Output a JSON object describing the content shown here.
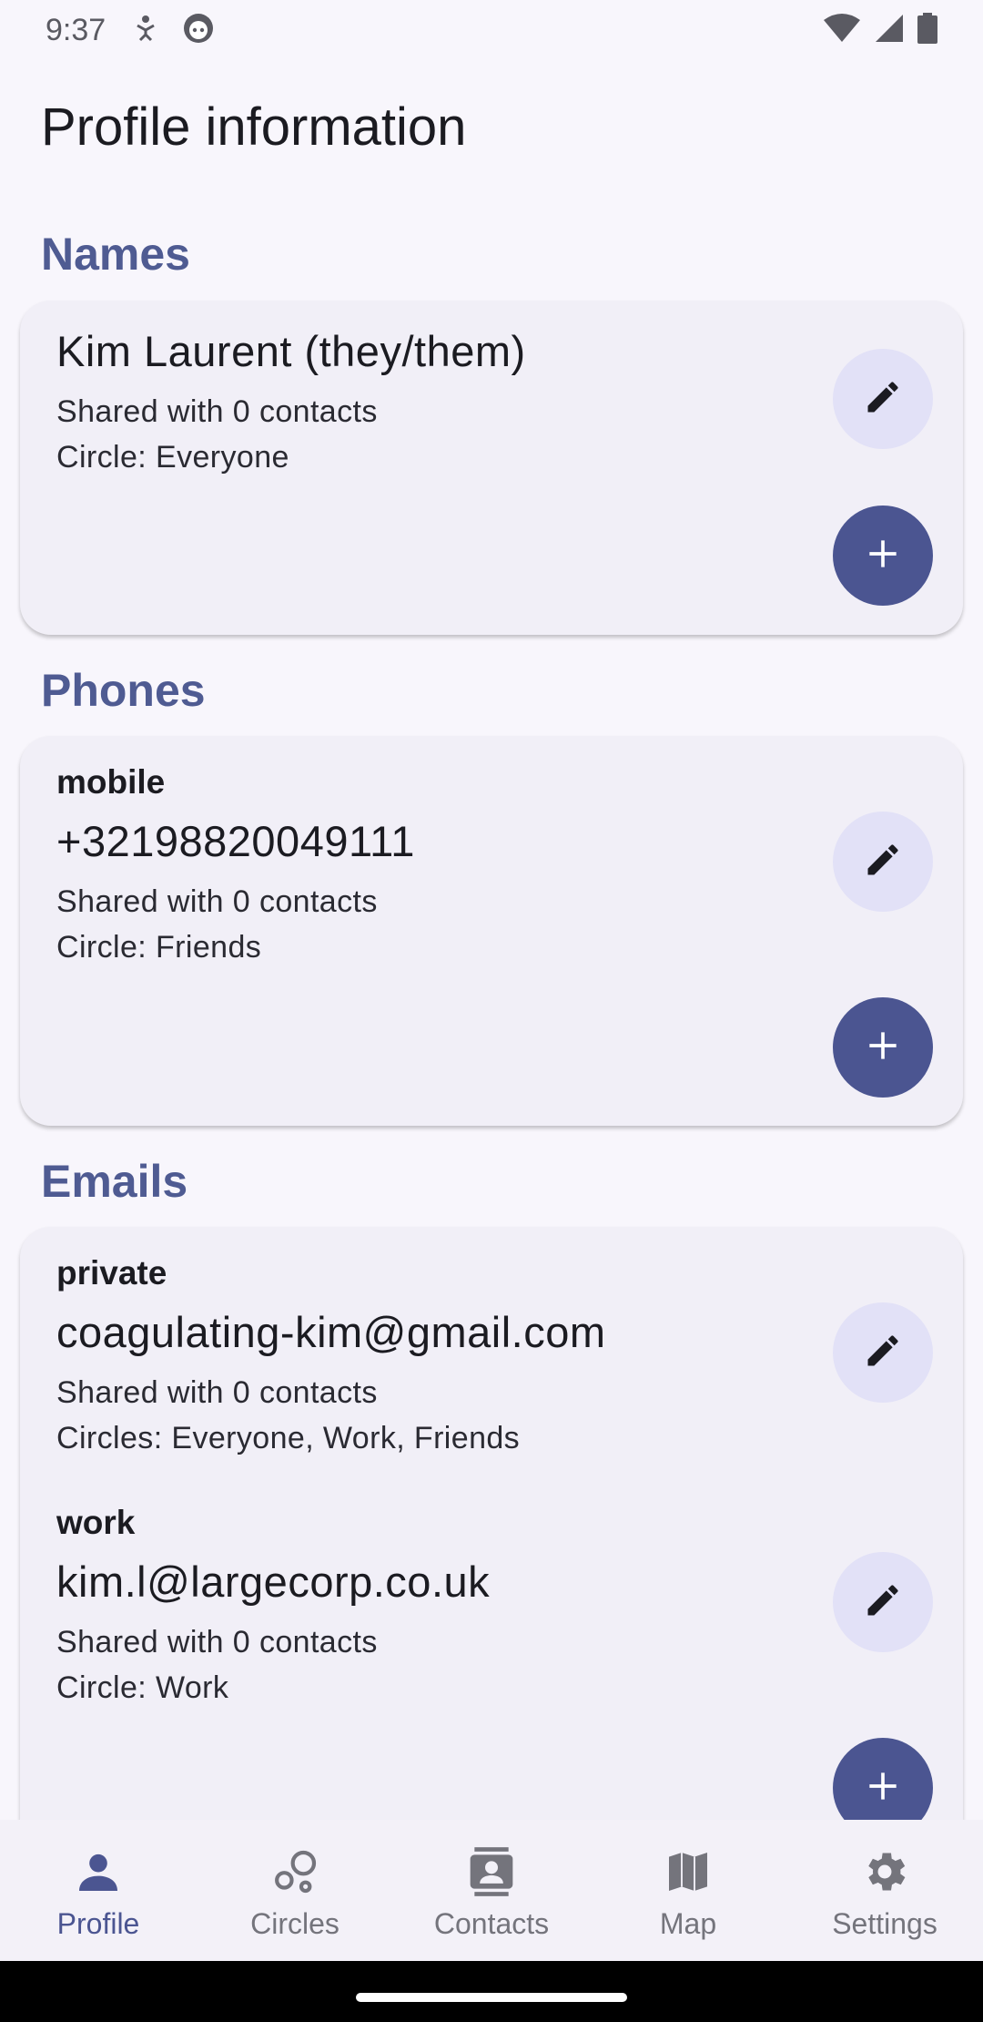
{
  "status_bar": {
    "time": "9:37"
  },
  "page": {
    "title": "Profile information"
  },
  "names": {
    "title": "Names",
    "entries": [
      {
        "value": "Kim Laurent (they/them)",
        "shared": "Shared with 0 contacts",
        "circles": "Circle: Everyone"
      }
    ]
  },
  "phones": {
    "title": "Phones",
    "entries": [
      {
        "label": "mobile",
        "value": "+32198820049111",
        "shared": "Shared with 0 contacts",
        "circles": "Circle: Friends"
      }
    ]
  },
  "emails": {
    "title": "Emails",
    "entries": [
      {
        "label": "private",
        "value": "coagulating-kim@gmail.com",
        "shared": "Shared with 0 contacts",
        "circles": "Circles: Everyone, Work, Friends"
      },
      {
        "label": "work",
        "value": "kim.l@largecorp.co.uk",
        "shared": "Shared with 0 contacts",
        "circles": "Circle: Work"
      }
    ]
  },
  "bottom_nav": {
    "items": [
      {
        "label": "Profile",
        "icon": "person-icon",
        "active": true
      },
      {
        "label": "Circles",
        "icon": "bubbles-icon",
        "active": false
      },
      {
        "label": "Contacts",
        "icon": "contacts-icon",
        "active": false
      },
      {
        "label": "Map",
        "icon": "map-icon",
        "active": false
      },
      {
        "label": "Settings",
        "icon": "gear-icon",
        "active": false
      }
    ]
  },
  "colors": {
    "accent": "#4f5b92",
    "add_button": "#4b5591",
    "edit_button": "#e2e1f7",
    "card": "#f1eff7",
    "background": "#f8f6fc"
  }
}
